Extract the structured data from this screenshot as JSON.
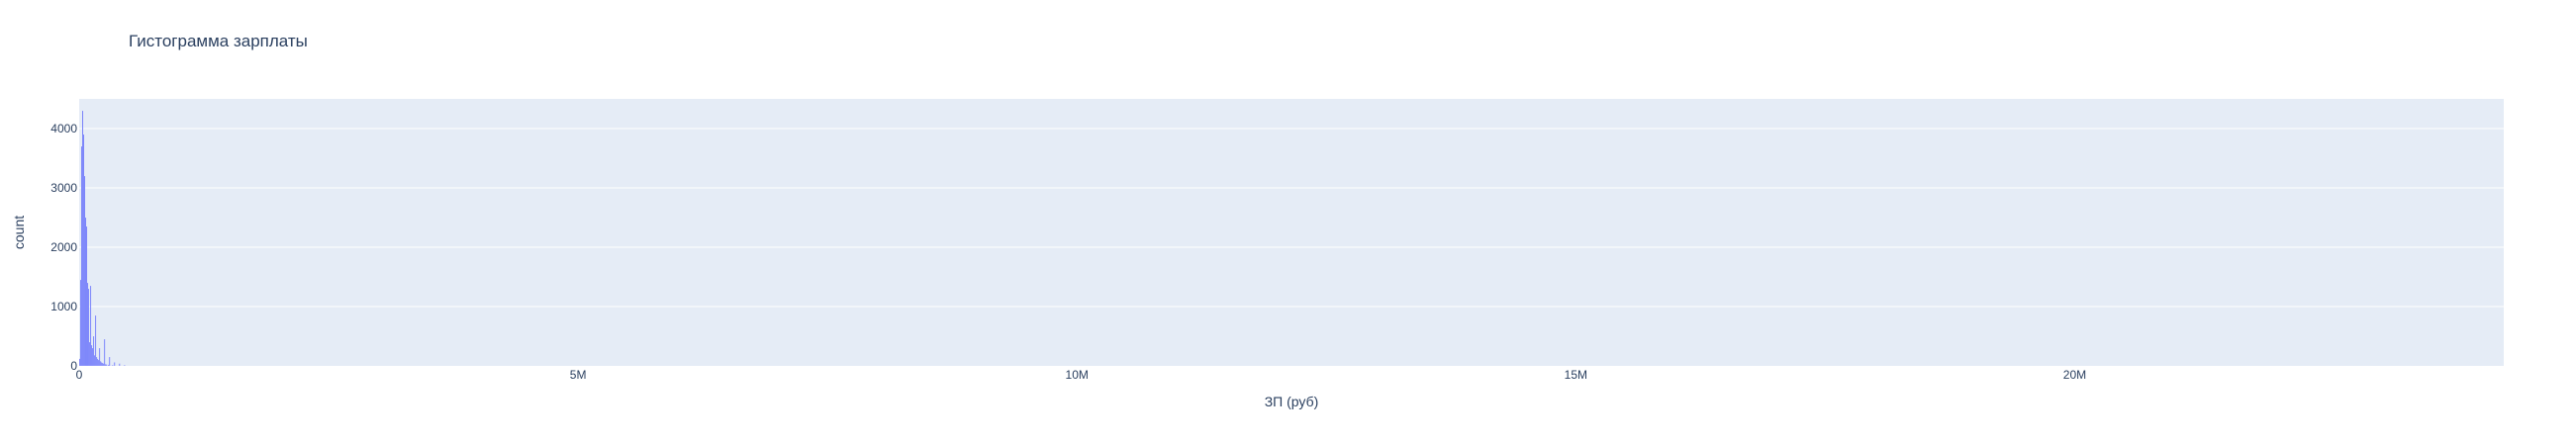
{
  "chart_data": {
    "type": "bar",
    "title": "Гистограмма зарплаты",
    "xlabel": "ЗП (руб)",
    "ylabel": "count",
    "xlim": [
      0,
      24300000
    ],
    "ylim": [
      0,
      4500
    ],
    "x_ticks": [
      {
        "value": 0,
        "label": "0"
      },
      {
        "value": 5000000,
        "label": "5M"
      },
      {
        "value": 10000000,
        "label": "10M"
      },
      {
        "value": 15000000,
        "label": "15M"
      },
      {
        "value": 20000000,
        "label": "20M"
      }
    ],
    "y_ticks": [
      {
        "value": 0,
        "label": "0"
      },
      {
        "value": 1000,
        "label": "1000"
      },
      {
        "value": 2000,
        "label": "2000"
      },
      {
        "value": 3000,
        "label": "3000"
      },
      {
        "value": 4000,
        "label": "4000"
      }
    ],
    "bin_width": 10000,
    "bins": [
      {
        "x": 5000,
        "count": 120
      },
      {
        "x": 15000,
        "count": 1450
      },
      {
        "x": 25000,
        "count": 3700
      },
      {
        "x": 35000,
        "count": 4300
      },
      {
        "x": 45000,
        "count": 3900
      },
      {
        "x": 55000,
        "count": 3200
      },
      {
        "x": 65000,
        "count": 2500
      },
      {
        "x": 75000,
        "count": 2350
      },
      {
        "x": 85000,
        "count": 1400
      },
      {
        "x": 95000,
        "count": 1300
      },
      {
        "x": 105000,
        "count": 400
      },
      {
        "x": 115000,
        "count": 1350
      },
      {
        "x": 125000,
        "count": 350
      },
      {
        "x": 135000,
        "count": 300
      },
      {
        "x": 145000,
        "count": 500
      },
      {
        "x": 155000,
        "count": 180
      },
      {
        "x": 165000,
        "count": 850
      },
      {
        "x": 175000,
        "count": 150
      },
      {
        "x": 185000,
        "count": 120
      },
      {
        "x": 195000,
        "count": 100
      },
      {
        "x": 205000,
        "count": 300
      },
      {
        "x": 215000,
        "count": 80
      },
      {
        "x": 225000,
        "count": 60
      },
      {
        "x": 235000,
        "count": 50
      },
      {
        "x": 245000,
        "count": 40
      },
      {
        "x": 255000,
        "count": 450
      },
      {
        "x": 265000,
        "count": 30
      },
      {
        "x": 275000,
        "count": 25
      },
      {
        "x": 295000,
        "count": 20
      },
      {
        "x": 305000,
        "count": 150
      },
      {
        "x": 335000,
        "count": 15
      },
      {
        "x": 355000,
        "count": 60
      },
      {
        "x": 405000,
        "count": 40
      },
      {
        "x": 455000,
        "count": 15
      }
    ],
    "bar_color": "#636efa",
    "plot_bgcolor": "#e5ecf6",
    "grid": true,
    "legend": false
  }
}
